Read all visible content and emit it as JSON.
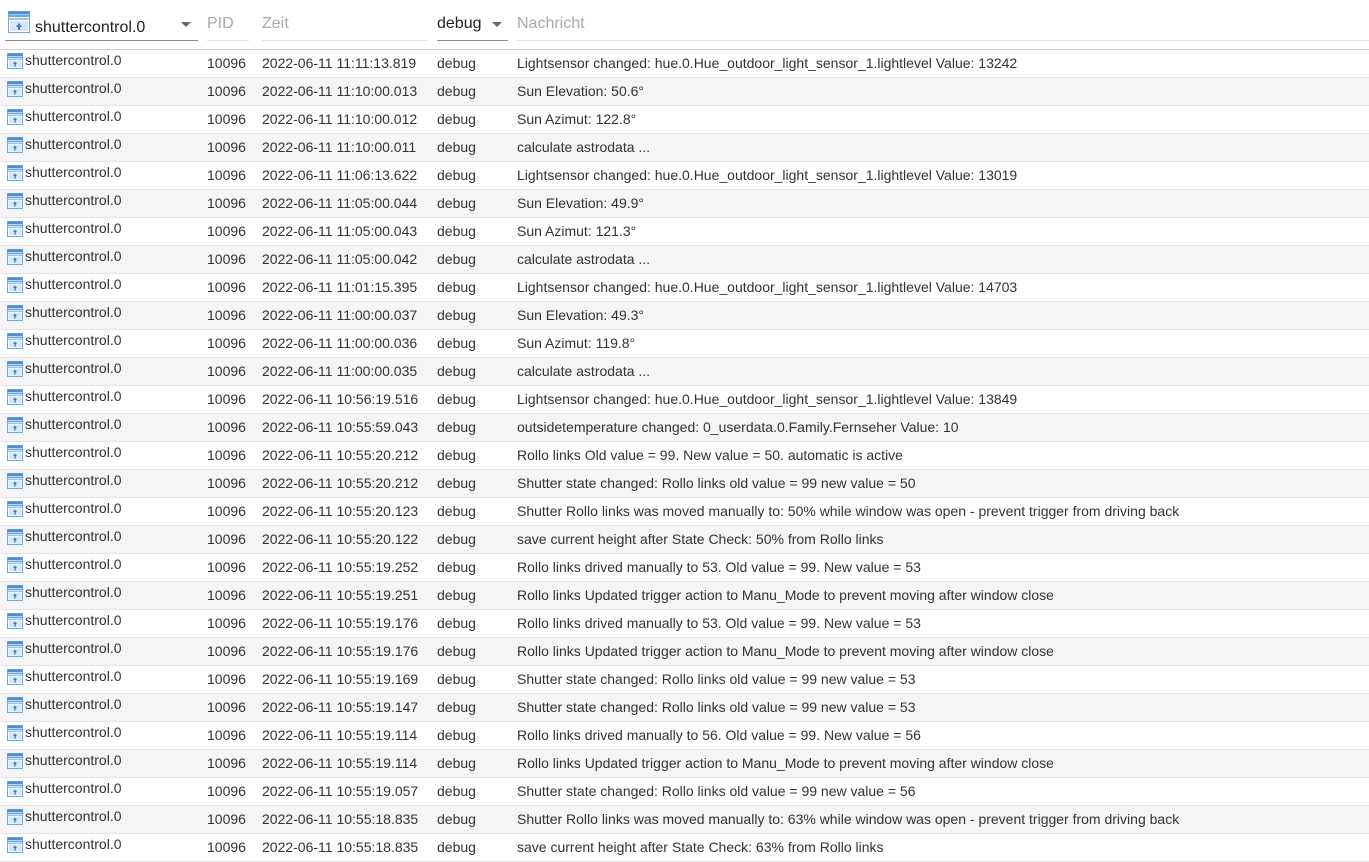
{
  "header": {
    "adapter_filter": "shuttercontrol.0",
    "pid_label": "PID",
    "time_label": "Zeit",
    "level_filter": "debug",
    "message_label": "Nachricht"
  },
  "colors": {
    "icon_blue": "#4a90d9",
    "icon_light": "#d5e8f8"
  },
  "rows": [
    {
      "source": "shuttercontrol.0",
      "pid": "10096",
      "time": "2022-06-11 11:11:13.819",
      "level": "debug",
      "message": "Lightsensor changed: hue.0.Hue_outdoor_light_sensor_1.lightlevel Value: 13242"
    },
    {
      "source": "shuttercontrol.0",
      "pid": "10096",
      "time": "2022-06-11 11:10:00.013",
      "level": "debug",
      "message": "Sun Elevation: 50.6°"
    },
    {
      "source": "shuttercontrol.0",
      "pid": "10096",
      "time": "2022-06-11 11:10:00.012",
      "level": "debug",
      "message": "Sun Azimut: 122.8°"
    },
    {
      "source": "shuttercontrol.0",
      "pid": "10096",
      "time": "2022-06-11 11:10:00.011",
      "level": "debug",
      "message": "calculate astrodata ..."
    },
    {
      "source": "shuttercontrol.0",
      "pid": "10096",
      "time": "2022-06-11 11:06:13.622",
      "level": "debug",
      "message": "Lightsensor changed: hue.0.Hue_outdoor_light_sensor_1.lightlevel Value: 13019"
    },
    {
      "source": "shuttercontrol.0",
      "pid": "10096",
      "time": "2022-06-11 11:05:00.044",
      "level": "debug",
      "message": "Sun Elevation: 49.9°"
    },
    {
      "source": "shuttercontrol.0",
      "pid": "10096",
      "time": "2022-06-11 11:05:00.043",
      "level": "debug",
      "message": "Sun Azimut: 121.3°"
    },
    {
      "source": "shuttercontrol.0",
      "pid": "10096",
      "time": "2022-06-11 11:05:00.042",
      "level": "debug",
      "message": "calculate astrodata ..."
    },
    {
      "source": "shuttercontrol.0",
      "pid": "10096",
      "time": "2022-06-11 11:01:15.395",
      "level": "debug",
      "message": "Lightsensor changed: hue.0.Hue_outdoor_light_sensor_1.lightlevel Value: 14703"
    },
    {
      "source": "shuttercontrol.0",
      "pid": "10096",
      "time": "2022-06-11 11:00:00.037",
      "level": "debug",
      "message": "Sun Elevation: 49.3°"
    },
    {
      "source": "shuttercontrol.0",
      "pid": "10096",
      "time": "2022-06-11 11:00:00.036",
      "level": "debug",
      "message": "Sun Azimut: 119.8°"
    },
    {
      "source": "shuttercontrol.0",
      "pid": "10096",
      "time": "2022-06-11 11:00:00.035",
      "level": "debug",
      "message": "calculate astrodata ..."
    },
    {
      "source": "shuttercontrol.0",
      "pid": "10096",
      "time": "2022-06-11 10:56:19.516",
      "level": "debug",
      "message": "Lightsensor changed: hue.0.Hue_outdoor_light_sensor_1.lightlevel Value: 13849"
    },
    {
      "source": "shuttercontrol.0",
      "pid": "10096",
      "time": "2022-06-11 10:55:59.043",
      "level": "debug",
      "message": "outsidetemperature changed: 0_userdata.0.Family.Fernseher Value: 10"
    },
    {
      "source": "shuttercontrol.0",
      "pid": "10096",
      "time": "2022-06-11 10:55:20.212",
      "level": "debug",
      "message": "Rollo links Old value = 99. New value = 50. automatic is active"
    },
    {
      "source": "shuttercontrol.0",
      "pid": "10096",
      "time": "2022-06-11 10:55:20.212",
      "level": "debug",
      "message": "Shutter state changed: Rollo links old value = 99 new value = 50"
    },
    {
      "source": "shuttercontrol.0",
      "pid": "10096",
      "time": "2022-06-11 10:55:20.123",
      "level": "debug",
      "message": "Shutter Rollo links was moved manually to: 50% while window was open - prevent trigger from driving back"
    },
    {
      "source": "shuttercontrol.0",
      "pid": "10096",
      "time": "2022-06-11 10:55:20.122",
      "level": "debug",
      "message": "save current height after State Check: 50% from Rollo links"
    },
    {
      "source": "shuttercontrol.0",
      "pid": "10096",
      "time": "2022-06-11 10:55:19.252",
      "level": "debug",
      "message": "Rollo links drived manually to 53. Old value = 99. New value = 53"
    },
    {
      "source": "shuttercontrol.0",
      "pid": "10096",
      "time": "2022-06-11 10:55:19.251",
      "level": "debug",
      "message": "Rollo links Updated trigger action to Manu_Mode to prevent moving after window close"
    },
    {
      "source": "shuttercontrol.0",
      "pid": "10096",
      "time": "2022-06-11 10:55:19.176",
      "level": "debug",
      "message": "Rollo links drived manually to 53. Old value = 99. New value = 53"
    },
    {
      "source": "shuttercontrol.0",
      "pid": "10096",
      "time": "2022-06-11 10:55:19.176",
      "level": "debug",
      "message": "Rollo links Updated trigger action to Manu_Mode to prevent moving after window close"
    },
    {
      "source": "shuttercontrol.0",
      "pid": "10096",
      "time": "2022-06-11 10:55:19.169",
      "level": "debug",
      "message": "Shutter state changed: Rollo links old value = 99 new value = 53"
    },
    {
      "source": "shuttercontrol.0",
      "pid": "10096",
      "time": "2022-06-11 10:55:19.147",
      "level": "debug",
      "message": "Shutter state changed: Rollo links old value = 99 new value = 53"
    },
    {
      "source": "shuttercontrol.0",
      "pid": "10096",
      "time": "2022-06-11 10:55:19.114",
      "level": "debug",
      "message": "Rollo links drived manually to 56. Old value = 99. New value = 56"
    },
    {
      "source": "shuttercontrol.0",
      "pid": "10096",
      "time": "2022-06-11 10:55:19.114",
      "level": "debug",
      "message": "Rollo links Updated trigger action to Manu_Mode to prevent moving after window close"
    },
    {
      "source": "shuttercontrol.0",
      "pid": "10096",
      "time": "2022-06-11 10:55:19.057",
      "level": "debug",
      "message": "Shutter state changed: Rollo links old value = 99 new value = 56"
    },
    {
      "source": "shuttercontrol.0",
      "pid": "10096",
      "time": "2022-06-11 10:55:18.835",
      "level": "debug",
      "message": "Shutter Rollo links was moved manually to: 63% while window was open - prevent trigger from driving back"
    },
    {
      "source": "shuttercontrol.0",
      "pid": "10096",
      "time": "2022-06-11 10:55:18.835",
      "level": "debug",
      "message": "save current height after State Check: 63% from Rollo links"
    }
  ]
}
